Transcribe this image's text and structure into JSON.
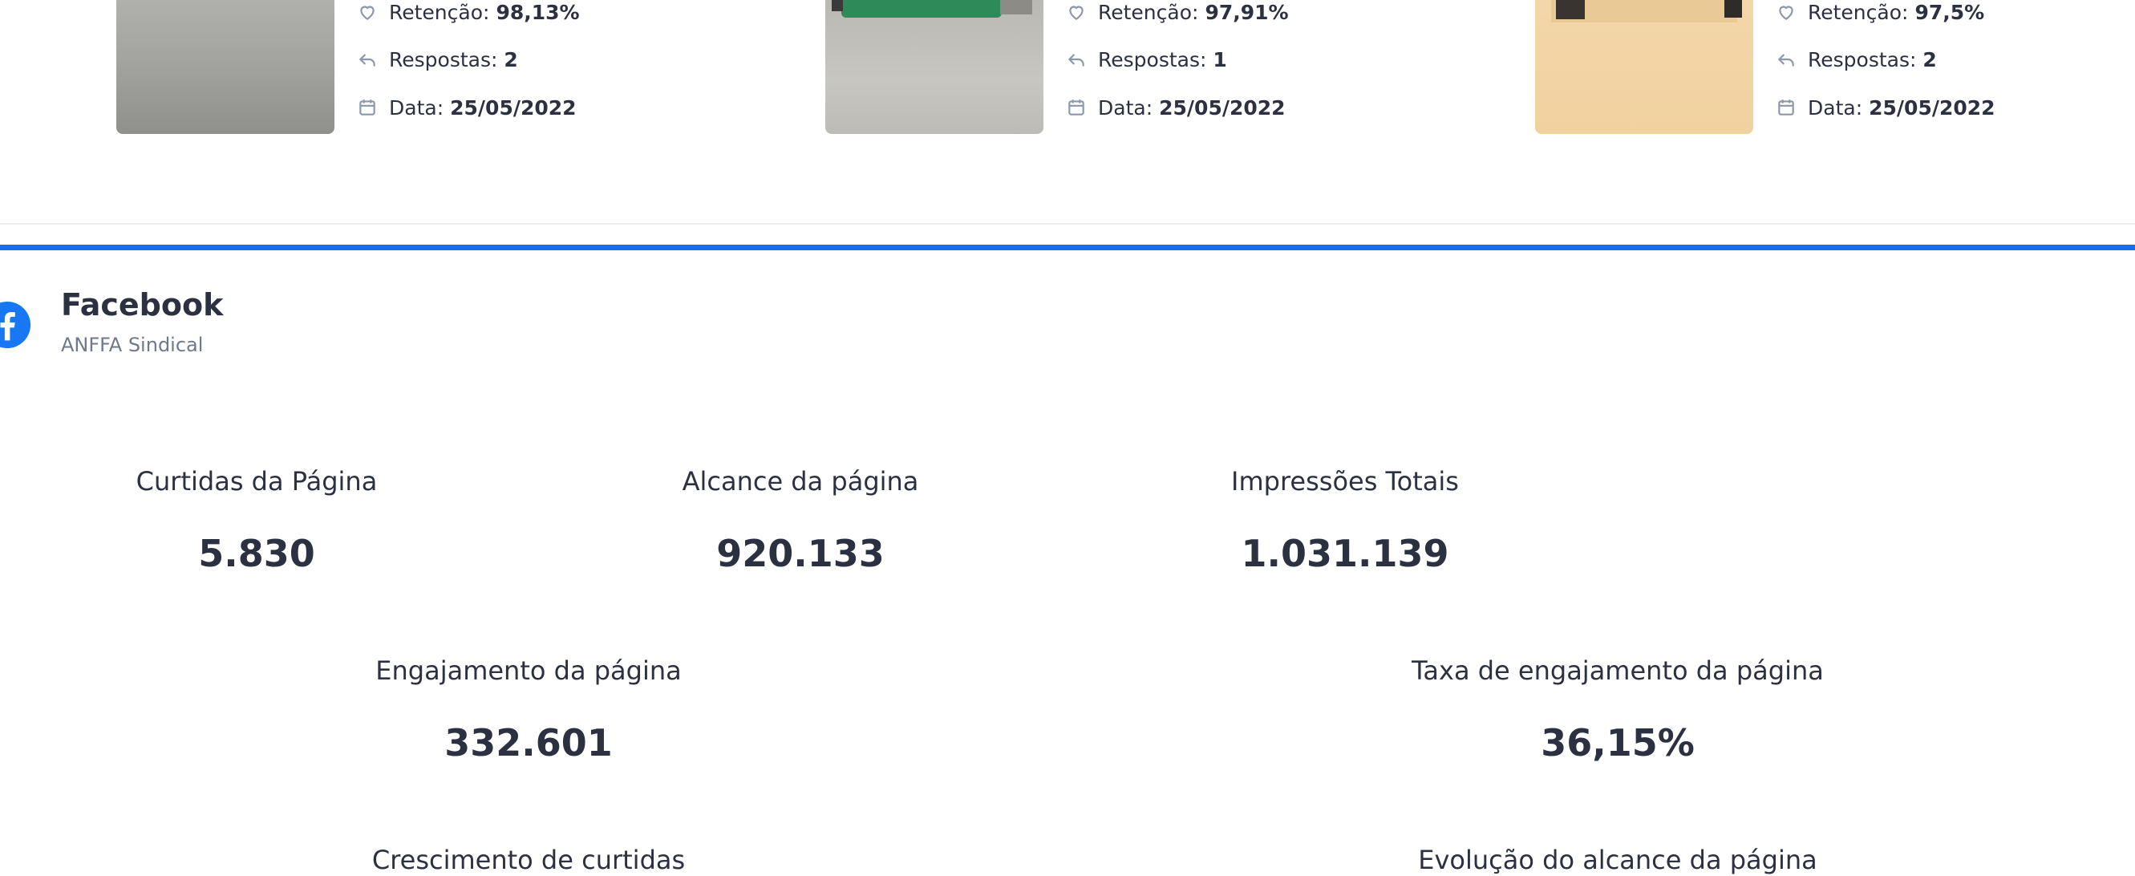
{
  "posts": [
    {
      "retention_label": "Retenção:",
      "retention_value": "98,13%",
      "replies_label": "Respostas:",
      "replies_value": "2",
      "date_label": "Data:",
      "date_value": "25/05/2022"
    },
    {
      "retention_label": "Retenção:",
      "retention_value": "97,91%",
      "replies_label": "Respostas:",
      "replies_value": "1",
      "date_label": "Data:",
      "date_value": "25/05/2022"
    },
    {
      "retention_label": "Retenção:",
      "retention_value": "97,5%",
      "replies_label": "Respostas:",
      "replies_value": "2",
      "date_label": "Data:",
      "date_value": "25/05/2022"
    }
  ],
  "facebook": {
    "title": "Facebook",
    "subtitle": "ANFFA Sindical",
    "brand_color": "#1877f2"
  },
  "metrics": {
    "page_likes": {
      "label": "Curtidas da Página",
      "value": "5.830"
    },
    "page_reach": {
      "label": "Alcance da página",
      "value": "920.133"
    },
    "total_impressions": {
      "label": "Impressões Totais",
      "value": "1.031.139"
    },
    "page_engagement": {
      "label": "Engajamento da página",
      "value": "332.601"
    },
    "engagement_rate": {
      "label": "Taxa de engajamento da página",
      "value": "36,15%"
    }
  },
  "sections": {
    "likes_growth": "Crescimento de curtidas",
    "reach_evolution": "Evolução do alcance da página"
  },
  "colors": {
    "accent_blue": "#1a6ee8",
    "icon_gray": "#8a98aa",
    "text_dark": "#2b3140",
    "text_muted": "#6c7a8c"
  }
}
